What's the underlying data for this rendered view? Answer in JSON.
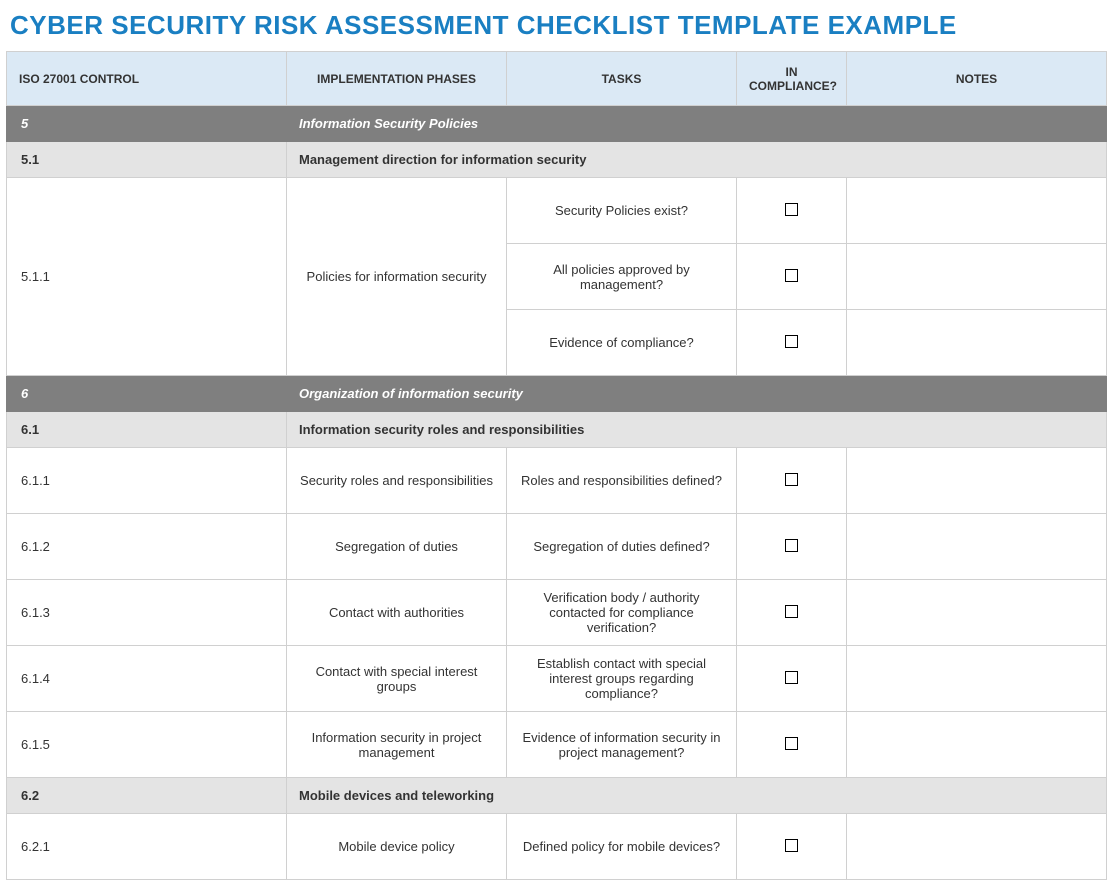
{
  "title": "CYBER SECURITY RISK ASSESSMENT CHECKLIST TEMPLATE EXAMPLE",
  "columns": {
    "control": "ISO 27001 CONTROL",
    "phases": "IMPLEMENTATION PHASES",
    "tasks": "TASKS",
    "compliance": "IN COMPLIANCE?",
    "notes": "NOTES"
  },
  "rows": [
    {
      "type": "section-dark",
      "num": "5",
      "label": "Information Security Policies"
    },
    {
      "type": "section-light",
      "num": "5.1",
      "label": "Management direction for information security"
    },
    {
      "type": "data",
      "control": "5.1.1",
      "phase": "Policies for information security",
      "tasks": [
        "Security Policies exist?",
        "All policies approved by management?",
        "Evidence of compliance?"
      ]
    },
    {
      "type": "section-dark",
      "num": "6",
      "label": "Organization of information security"
    },
    {
      "type": "section-light",
      "num": "6.1",
      "label": "Information security roles and responsibilities"
    },
    {
      "type": "data",
      "control": "6.1.1",
      "phase": "Security roles and responsibilities",
      "tasks": [
        "Roles and responsibilities defined?"
      ]
    },
    {
      "type": "data",
      "control": "6.1.2",
      "phase": "Segregation of duties",
      "tasks": [
        "Segregation of duties defined?"
      ]
    },
    {
      "type": "data",
      "control": "6.1.3",
      "phase": "Contact with authorities",
      "tasks": [
        "Verification body / authority contacted for compliance verification?"
      ]
    },
    {
      "type": "data",
      "control": "6.1.4",
      "phase": "Contact with special interest groups",
      "tasks": [
        "Establish contact with special interest groups regarding compliance?"
      ]
    },
    {
      "type": "data",
      "control": "6.1.5",
      "phase": "Information security in project management",
      "tasks": [
        "Evidence of information security in project management?"
      ]
    },
    {
      "type": "section-light",
      "num": "6.2",
      "label": "Mobile devices and teleworking"
    },
    {
      "type": "data",
      "control": "6.2.1",
      "phase": "Mobile device policy",
      "tasks": [
        "Defined policy for mobile devices?"
      ]
    }
  ]
}
